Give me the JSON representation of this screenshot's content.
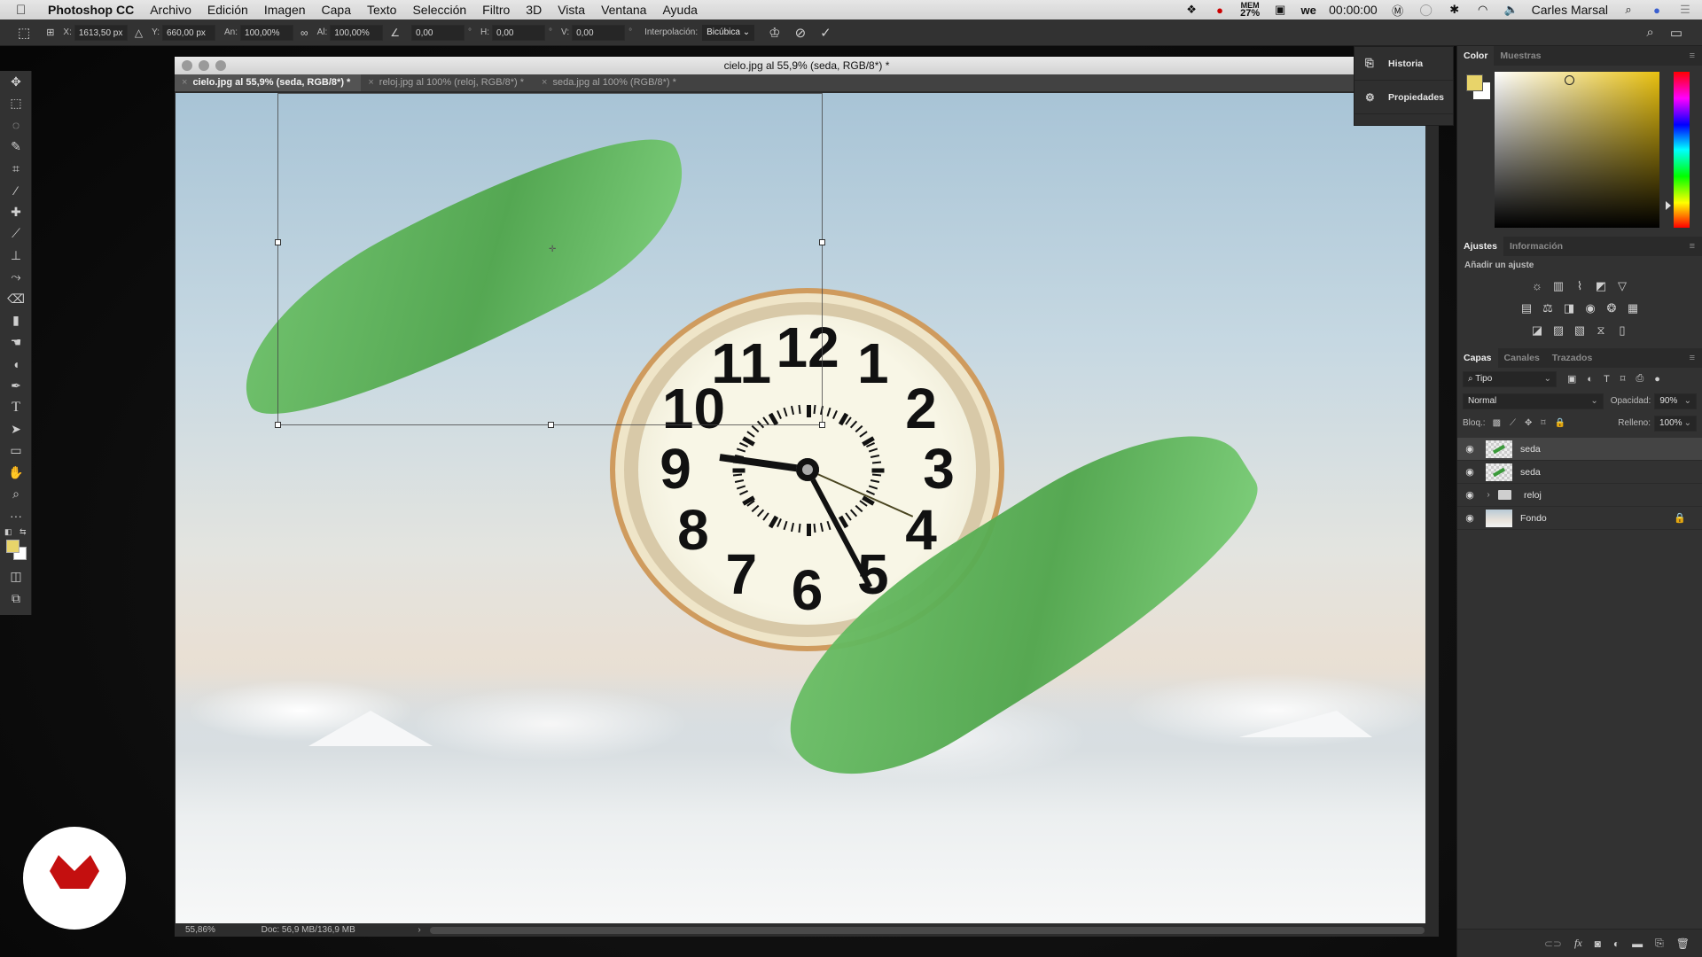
{
  "menubar": {
    "apple": "",
    "app_name": "Photoshop CC",
    "items": [
      "Archivo",
      "Edición",
      "Imagen",
      "Capa",
      "Texto",
      "Selección",
      "Filtro",
      "3D",
      "Vista",
      "Ventana",
      "Ayuda"
    ],
    "mem_label": "MEM",
    "mem_value": "27%",
    "clock": "00:00:00",
    "user": "Carles Marsal"
  },
  "options_bar": {
    "x_label": "X:",
    "x_value": "1613,50 px",
    "y_label": "Y:",
    "y_value": "660,00 px",
    "w_label": "An:",
    "w_value": "100,00%",
    "h_label": "Al:",
    "h_value": "100,00%",
    "angle_value": "0,00",
    "hskew_label": "H:",
    "hskew_value": "0,00",
    "vskew_label": "V:",
    "vskew_value": "0,00",
    "interp_label": "Interpolación:",
    "interp_value": "Bicúbica",
    "degree": "°"
  },
  "document": {
    "window_title": "cielo.jpg al 55,9% (seda, RGB/8*) *",
    "tabs": [
      {
        "label": "cielo.jpg al 55,9% (seda, RGB/8*) *",
        "active": true
      },
      {
        "label": "reloj.jpg al 100% (reloj, RGB/8*) *",
        "active": false
      },
      {
        "label": "seda.jpg al 100% (RGB/8*) *",
        "active": false
      }
    ],
    "tab_close": "×",
    "zoom": "55,86%",
    "doc_size": "Doc: 56,9 MB/136,9 MB",
    "clock_numbers": [
      "12",
      "1",
      "2",
      "3",
      "4",
      "5",
      "6",
      "7",
      "8",
      "9",
      "10",
      "11"
    ]
  },
  "dock": {
    "items": [
      {
        "label": "Historia"
      },
      {
        "label": "Propiedades"
      }
    ]
  },
  "color_panel": {
    "tabs": [
      "Color",
      "Muestras"
    ],
    "foreground": "#e8d46a",
    "background": "#ffffff"
  },
  "adjustments_panel": {
    "tabs": [
      "Ajustes",
      "Información"
    ],
    "add_label": "Añadir un ajuste"
  },
  "layers_panel": {
    "tabs": [
      "Capas",
      "Canales",
      "Trazados"
    ],
    "filter": "Tipo",
    "blend_mode": "Normal",
    "opacity_label": "Opacidad:",
    "opacity_value": "90%",
    "lock_label": "Bloq.:",
    "fill_label": "Relleno:",
    "fill_value": "100%",
    "layers": [
      {
        "name": "seda",
        "selected": true,
        "type": "smart"
      },
      {
        "name": "seda",
        "selected": false,
        "type": "smart"
      },
      {
        "name": "reloj",
        "selected": false,
        "type": "group"
      },
      {
        "name": "Fondo",
        "selected": false,
        "type": "background",
        "locked": true
      }
    ]
  }
}
